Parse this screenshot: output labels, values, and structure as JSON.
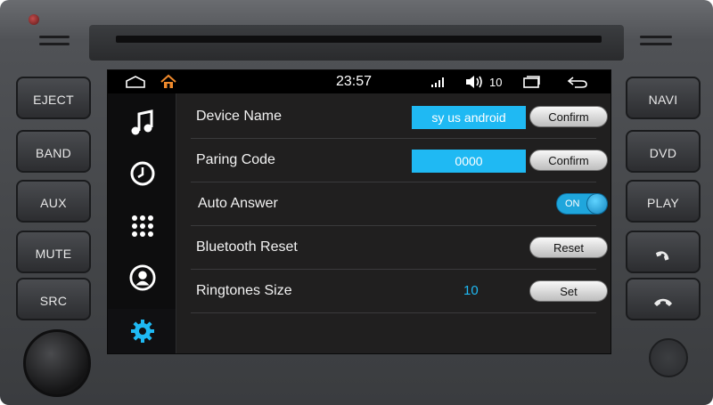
{
  "statusbar": {
    "time": "23:57",
    "volume": "10",
    "icons": {
      "home": "home-outline-icon",
      "apps": "house-icon",
      "signal": "signal-icon",
      "speaker": "speaker-icon",
      "recents": "recents-icon",
      "back": "back-icon"
    }
  },
  "left_buttons": [
    {
      "label": "EJECT"
    },
    {
      "label": "BAND"
    },
    {
      "label": "AUX"
    },
    {
      "label": "MUTE"
    },
    {
      "label": "SRC"
    }
  ],
  "right_buttons": [
    {
      "label": "NAVI"
    },
    {
      "label": "DVD"
    },
    {
      "label": "PLAY"
    },
    {
      "icon": "answer-call-icon"
    },
    {
      "icon": "hang-up-icon"
    }
  ],
  "sidebar": {
    "items": [
      {
        "icon": "music-note-icon"
      },
      {
        "icon": "clock-icon"
      },
      {
        "icon": "dialpad-icon"
      },
      {
        "icon": "contact-icon"
      },
      {
        "icon": "gear-icon",
        "active": true
      }
    ]
  },
  "settings": {
    "device_name": {
      "label": "Device Name",
      "value": "sy us android",
      "button": "Confirm"
    },
    "pairing_code": {
      "label": "Paring Code",
      "value": "0000",
      "button": "Confirm"
    },
    "auto_answer": {
      "label": "Auto Answer",
      "toggle": "ON"
    },
    "bluetooth_reset": {
      "label": "Bluetooth Reset",
      "button": "Reset"
    },
    "ringtones": {
      "label": "Ringtones Size",
      "value": "10",
      "button": "Set"
    }
  },
  "colors": {
    "accent": "#1fb9f3",
    "background": "#201f1f",
    "sidebar": "#0d0d0e"
  }
}
